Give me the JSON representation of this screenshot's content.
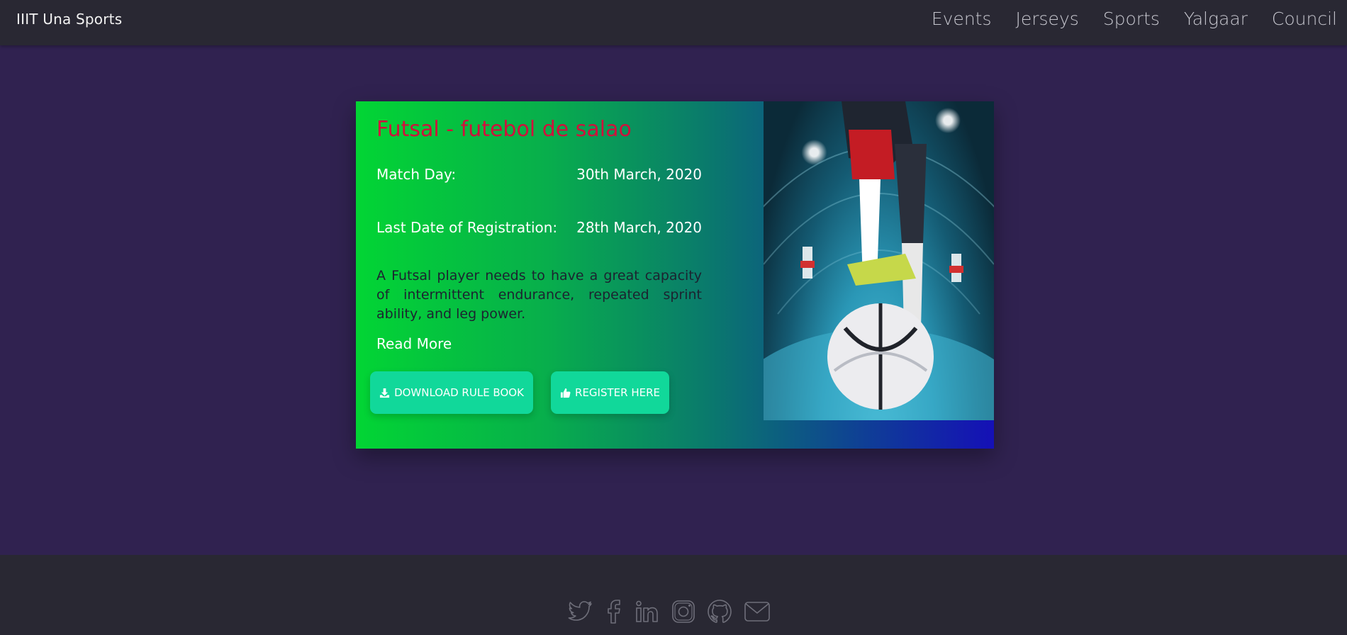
{
  "navbar": {
    "brand": "IIIT Una Sports",
    "links": [
      "Events",
      "Jerseys",
      "Sports",
      "Yalgaar",
      "Council"
    ]
  },
  "event": {
    "title": "Futsal - futebol de salao",
    "match_day_label": "Match Day:",
    "match_day_value": "30th March, 2020",
    "registration_label": "Last Date of Registration:",
    "registration_value": "28th March, 2020",
    "description": "A Futsal player needs to have a great capacity of intermittent endurance, repeated sprint ability, and leg power.",
    "read_more": "Read More",
    "download_label": "DOWNLOAD RULE BOOK",
    "register_label": "REGISTER HERE"
  },
  "footer": {
    "icons": [
      "twitter-icon",
      "facebook-icon",
      "linkedin-icon",
      "instagram-icon",
      "github-icon",
      "mail-icon"
    ]
  },
  "colors": {
    "page_bg": "#302250",
    "bar_bg": "#292833",
    "title": "#d1103c",
    "button": "#11d89a",
    "gradient_start": "#02d534",
    "gradient_end": "#1510b6"
  }
}
